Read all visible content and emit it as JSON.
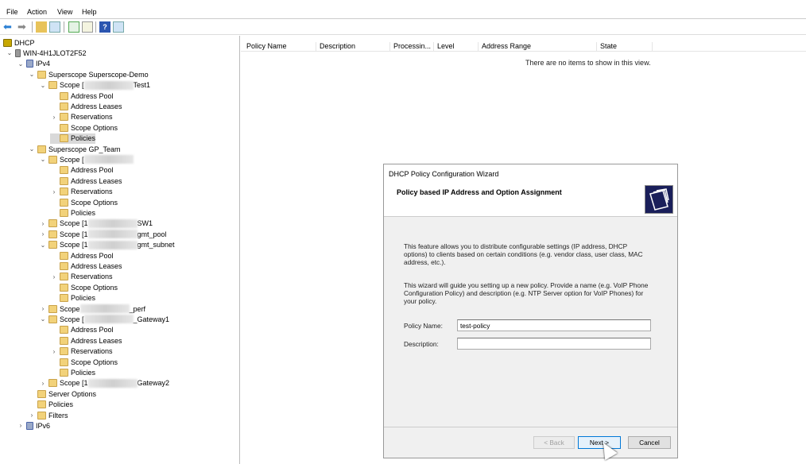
{
  "menu": [
    "File",
    "Action",
    "View",
    "Help"
  ],
  "toolbar": [
    "back-icon",
    "forward-icon",
    "up-folder-icon",
    "show-hide-tree-icon",
    "refresh-icon",
    "export-list-icon",
    "help-icon",
    "action-pane-icon"
  ],
  "tree": [
    {
      "label": "DHCP",
      "level": 0,
      "icon": "dhcp",
      "chev": ""
    },
    {
      "label": "WIN-4H1JLOT2F52",
      "level": 1,
      "icon": "srv",
      "chev": "v"
    },
    {
      "label": "IPv4",
      "level": 2,
      "icon": "ip",
      "chev": "v"
    },
    {
      "label": "Superscope Superscope-Demo",
      "level": 3,
      "icon": "folder",
      "chev": "v"
    },
    {
      "label": "Scope [",
      "suffix": "Test1",
      "blur": true,
      "level": 4,
      "icon": "folder",
      "chev": "v"
    },
    {
      "label": "Address Pool",
      "level": 5,
      "icon": "folder",
      "chev": ""
    },
    {
      "label": "Address Leases",
      "level": 5,
      "icon": "folder",
      "chev": ""
    },
    {
      "label": "Reservations",
      "level": 5,
      "icon": "folder",
      "chev": ">"
    },
    {
      "label": "Scope Options",
      "level": 5,
      "icon": "folder",
      "chev": ""
    },
    {
      "label": "Policies",
      "level": 5,
      "icon": "folder",
      "chev": "",
      "selected": true
    },
    {
      "label": "Superscope GP_Team",
      "level": 3,
      "icon": "folder",
      "chev": "v"
    },
    {
      "label": "Scope [",
      "suffix": "",
      "blur": true,
      "level": 4,
      "icon": "folder",
      "chev": "v"
    },
    {
      "label": "Address Pool",
      "level": 5,
      "icon": "folder",
      "chev": ""
    },
    {
      "label": "Address Leases",
      "level": 5,
      "icon": "folder",
      "chev": ""
    },
    {
      "label": "Reservations",
      "level": 5,
      "icon": "folder",
      "chev": ">"
    },
    {
      "label": "Scope Options",
      "level": 5,
      "icon": "folder",
      "chev": ""
    },
    {
      "label": "Policies",
      "level": 5,
      "icon": "folder",
      "chev": ""
    },
    {
      "label": "Scope [1",
      "suffix": "SW1",
      "blur": true,
      "level": 4,
      "icon": "folder",
      "chev": ">"
    },
    {
      "label": "Scope [1",
      "suffix": "gmt_pool",
      "blur": true,
      "level": 4,
      "icon": "folder",
      "chev": ">"
    },
    {
      "label": "Scope [1",
      "suffix": "gmt_subnet",
      "blur": true,
      "level": 4,
      "icon": "folder",
      "chev": "v"
    },
    {
      "label": "Address Pool",
      "level": 5,
      "icon": "folder",
      "chev": ""
    },
    {
      "label": "Address Leases",
      "level": 5,
      "icon": "folder",
      "chev": ""
    },
    {
      "label": "Reservations",
      "level": 5,
      "icon": "folder",
      "chev": ">"
    },
    {
      "label": "Scope Options",
      "level": 5,
      "icon": "folder",
      "chev": ""
    },
    {
      "label": "Policies",
      "level": 5,
      "icon": "folder",
      "chev": ""
    },
    {
      "label": "Scope",
      "suffix": "_perf",
      "blur": true,
      "level": 4,
      "icon": "folder",
      "chev": ">"
    },
    {
      "label": "Scope [",
      "suffix": "_Gateway1",
      "blur": true,
      "level": 4,
      "icon": "folder",
      "chev": "v"
    },
    {
      "label": "Address Pool",
      "level": 5,
      "icon": "folder",
      "chev": ""
    },
    {
      "label": "Address Leases",
      "level": 5,
      "icon": "folder",
      "chev": ""
    },
    {
      "label": "Reservations",
      "level": 5,
      "icon": "folder",
      "chev": ">"
    },
    {
      "label": "Scope Options",
      "level": 5,
      "icon": "folder",
      "chev": ""
    },
    {
      "label": "Policies",
      "level": 5,
      "icon": "folder",
      "chev": ""
    },
    {
      "label": "Scope [1",
      "suffix": "Gateway2",
      "blur": true,
      "level": 4,
      "icon": "folder",
      "chev": ">"
    },
    {
      "label": "Server Options",
      "level": 3,
      "icon": "folder",
      "chev": ""
    },
    {
      "label": "Policies",
      "level": 3,
      "icon": "folder",
      "chev": ""
    },
    {
      "label": "Filters",
      "level": 3,
      "icon": "folder",
      "chev": ">"
    },
    {
      "label": "IPv6",
      "level": 2,
      "icon": "ip",
      "chev": ">"
    }
  ],
  "list": {
    "columns": [
      "Policy Name",
      "Description",
      "Processin...",
      "Level",
      "Address Range",
      "State"
    ],
    "empty": "There are no items to show in this view."
  },
  "wizard": {
    "title": "DHCP Policy Configuration Wizard",
    "subtitle": "Policy based IP Address and Option Assignment",
    "para1": "This feature allows you to distribute configurable settings (IP address, DHCP options) to clients based on certain conditions (e.g. vendor class, user class, MAC address, etc.).",
    "para2": "This wizard will guide you setting up a new policy. Provide a name (e.g. VoIP Phone Configuration Policy) and description (e.g. NTP Server option for VoIP Phones) for your policy.",
    "name_label": "Policy Name:",
    "name_value": "test-policy",
    "desc_label": "Description:",
    "desc_value": "",
    "back": "< Back",
    "next": "Next >",
    "cancel": "Cancel"
  }
}
